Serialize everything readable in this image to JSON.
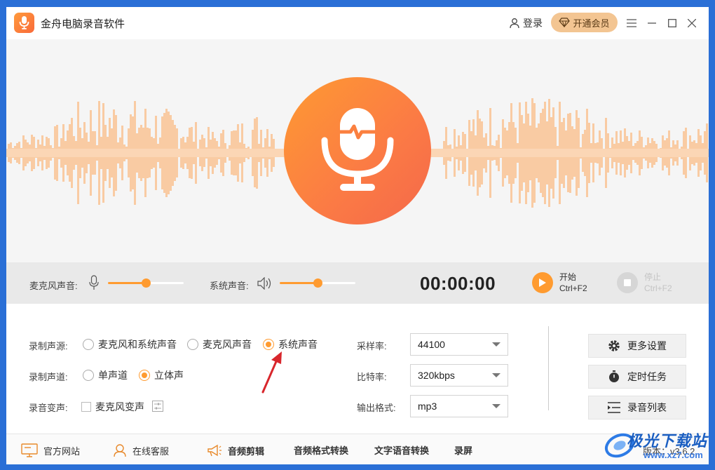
{
  "app": {
    "title": "金舟电脑录音软件"
  },
  "header": {
    "login_label": "登录",
    "vip_label": "开通会员"
  },
  "controls": {
    "mic_label": "麦克风声音:",
    "system_label": "系统声音:",
    "mic_level": 0.5,
    "system_level": 0.5,
    "timer": "00:00:00",
    "start_label": "开始",
    "start_hotkey": "Ctrl+F2",
    "stop_label": "停止",
    "stop_hotkey": "Ctrl+F2"
  },
  "settings": {
    "source_label": "录制声源:",
    "source_options": [
      "麦克风和系统声音",
      "麦克风声音",
      "系统声音"
    ],
    "source_selected": "系统声音",
    "channel_label": "录制声道:",
    "channel_options": [
      "单声道",
      "立体声"
    ],
    "channel_selected": "立体声",
    "voice_change_label": "录音变声:",
    "voice_change_option": "麦克风变声",
    "voice_change_checked": false,
    "sample_rate_label": "采样率:",
    "sample_rate_value": "44100",
    "bitrate_label": "比特率:",
    "bitrate_value": "320kbps",
    "format_label": "输出格式:",
    "format_value": "mp3"
  },
  "side_buttons": {
    "more_settings": "更多设置",
    "scheduled_task": "定时任务",
    "record_list": "录音列表"
  },
  "footer": {
    "website": "官方网站",
    "support": "在线客服",
    "audio_edit": "音频剪辑",
    "format_convert": "音频格式转换",
    "tts": "文字语音转换",
    "screen_record": "录屏",
    "version": "版本：v3.6.2"
  },
  "watermark": {
    "text": "极光下载站",
    "url": "www.xz7.com"
  },
  "colors": {
    "accent": "#ff9b30",
    "title_blue": "#2a6fd6"
  }
}
